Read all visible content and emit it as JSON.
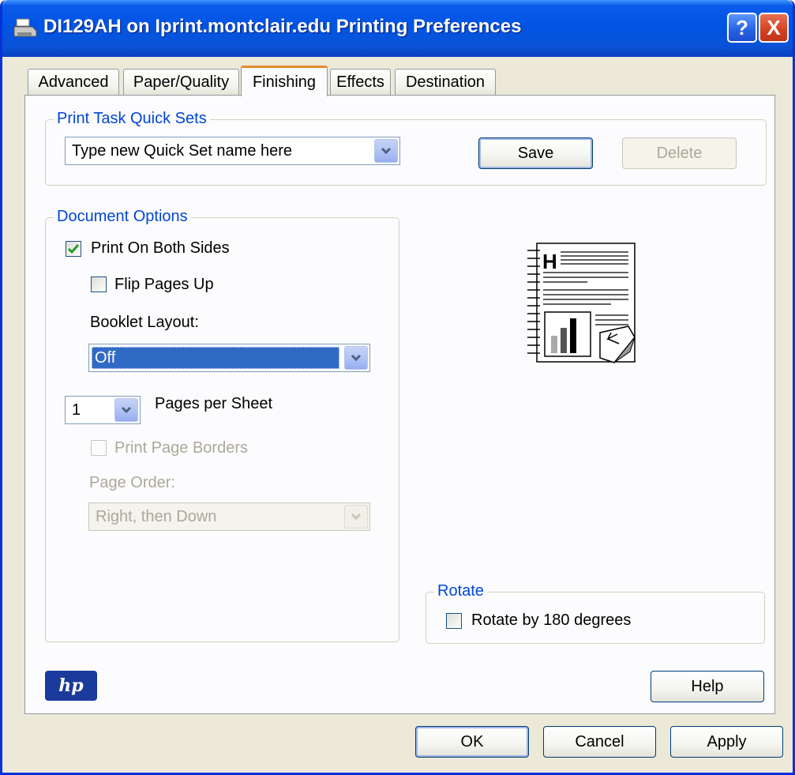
{
  "window": {
    "title": "DI129AH on Iprint.montclair.edu Printing Preferences",
    "help_glyph": "?",
    "close_glyph": "X"
  },
  "tabs": [
    {
      "label": "Advanced"
    },
    {
      "label": "Paper/Quality"
    },
    {
      "label": "Finishing"
    },
    {
      "label": "Effects"
    },
    {
      "label": "Destination"
    }
  ],
  "active_tab": "Finishing",
  "quick_sets": {
    "group_title": "Print Task Quick Sets",
    "combo_value": "Type new Quick Set name here",
    "save_label": "Save",
    "delete_label": "Delete"
  },
  "document_options": {
    "group_title": "Document Options",
    "print_both_sides": {
      "label": "Print On Both Sides",
      "checked": true
    },
    "flip_pages_up": {
      "label": "Flip Pages Up",
      "checked": false
    },
    "booklet_layout_label": "Booklet Layout:",
    "booklet_layout_value": "Off",
    "pages_per_sheet_value": "1",
    "pages_per_sheet_label": "Pages per Sheet",
    "print_page_borders": {
      "label": "Print Page Borders",
      "checked": false,
      "enabled": false
    },
    "page_order_label": "Page Order:",
    "page_order_value": "Right, then Down"
  },
  "preview": {
    "heading_glyph": "H"
  },
  "rotate": {
    "group_title": "Rotate",
    "rotate_180": {
      "label": "Rotate by 180 degrees",
      "checked": false
    }
  },
  "logo_text": "hp",
  "buttons": {
    "help": "Help",
    "ok": "OK",
    "cancel": "Cancel",
    "apply": "Apply"
  },
  "colors": {
    "titlebar": "#0054e3",
    "group_title": "#0046d5",
    "checkmark": "#21a121",
    "selection": "#316ac5",
    "tab_highlight": "#e68b2c"
  }
}
